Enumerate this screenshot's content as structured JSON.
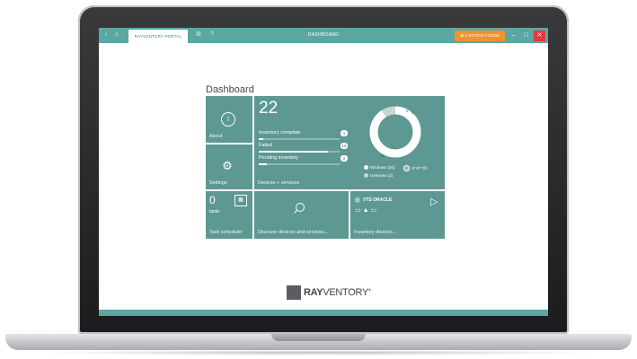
{
  "window": {
    "tab_label": "RAYVENTORY PORTAL",
    "title": "DASHBOARD",
    "notifications_label": "3 NOTIFICATIONS",
    "minimize": "–",
    "maximize": "□",
    "close": "✕"
  },
  "dashboard": {
    "title": "Dashboard",
    "about_label": "About",
    "settings_label": "Settings",
    "task_count": "0",
    "tasks_label": "tasks",
    "task_scheduler_label": "Task scheduler",
    "device_total": "22",
    "stats": [
      {
        "label": "Inventory complete",
        "value": "1",
        "fraction": 0.05
      },
      {
        "label": "Failed",
        "value": "19",
        "fraction": 0.86
      },
      {
        "label": "Pending inventory",
        "value": "2",
        "fraction": 0.1
      }
    ],
    "devices_services_label": "Devices + services",
    "donut": {
      "segments": [
        {
          "name": "Windows",
          "value": 20,
          "color": "#ffffff"
        },
        {
          "name": "Unix",
          "value": 0,
          "color": "#9fb7b4"
        },
        {
          "name": "Unknown",
          "value": 2,
          "color": "#c8d6d4"
        }
      ],
      "label_windows": "20",
      "label_unknown": "2",
      "label_unix": "0"
    },
    "legend": {
      "windows": "Windows (20)",
      "unix": "Unix* (0)",
      "unknown": "Unknown (2)"
    },
    "discover_label": "Discover devices and services...",
    "inventory_devices_label": "Inventory devices...",
    "vendor_label": "VTS ORACLE"
  },
  "brand": {
    "name_bold": "RAY",
    "name_rest": "VENTORY",
    "mark": "®"
  },
  "colors": {
    "accent": "#5aa7a3",
    "tile": "#5d9893",
    "notification": "#f0932b",
    "close": "#e03c3c"
  }
}
